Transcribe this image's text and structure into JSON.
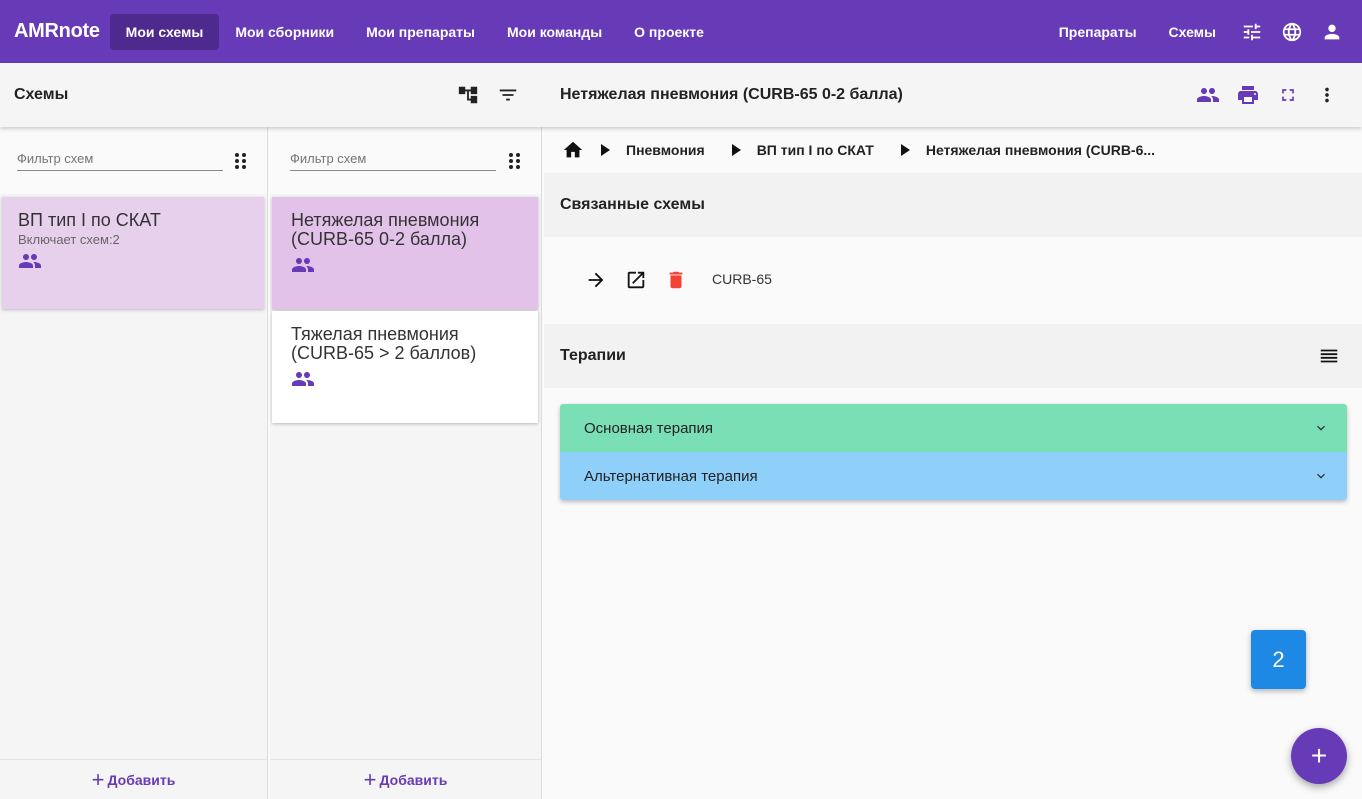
{
  "app": {
    "brand": "AMRnote"
  },
  "nav": {
    "left": [
      {
        "label": "Мои схемы",
        "active": true
      },
      {
        "label": "Мои сборники",
        "active": false
      },
      {
        "label": "Мои препараты",
        "active": false
      },
      {
        "label": "Мои команды",
        "active": false
      },
      {
        "label": "О проекте",
        "active": false
      }
    ],
    "right": [
      {
        "label": "Препараты"
      },
      {
        "label": "Схемы"
      }
    ],
    "right_icons": [
      "tune-icon",
      "globe-icon",
      "account-icon"
    ]
  },
  "toolbar": {
    "left_title": "Схемы",
    "right_title": "Нетяжелая пневмония (CURB-65 0-2 балла)"
  },
  "col1": {
    "filter_placeholder": "Фильтр схем",
    "cards": [
      {
        "title": "ВП тип I по СКАТ",
        "subtitle": "Включает схем:2",
        "icon": "group-icon"
      }
    ],
    "add_label": "Добавить"
  },
  "col2": {
    "filter_placeholder": "Фильтр схем",
    "cards": [
      {
        "title": "Нетяжелая пневмония (CURB-65 0-2 балла)",
        "icon": "group-icon"
      },
      {
        "title": "Тяжелая пневмония (CURB-65 > 2 баллов)",
        "icon": "group-icon"
      }
    ],
    "add_label": "Добавить"
  },
  "detail": {
    "breadcrumbs": [
      "Пневмония",
      "ВП тип I по СКАТ",
      "Нетяжелая пневмония (CURB-6..."
    ],
    "linked_section_title": "Связанные схемы",
    "linked_items": [
      {
        "name": "CURB-65"
      }
    ],
    "therapies_title": "Терапии",
    "therapies": [
      {
        "label": "Основная терапия",
        "color": "#7bdfb6"
      },
      {
        "label": "Альтернативная терапия",
        "color": "#8fd0fb"
      }
    ]
  },
  "badge": {
    "value": "2"
  },
  "fab": {
    "label": "+"
  },
  "colors": {
    "primary": "#673ab7",
    "delete": "#f44336"
  }
}
